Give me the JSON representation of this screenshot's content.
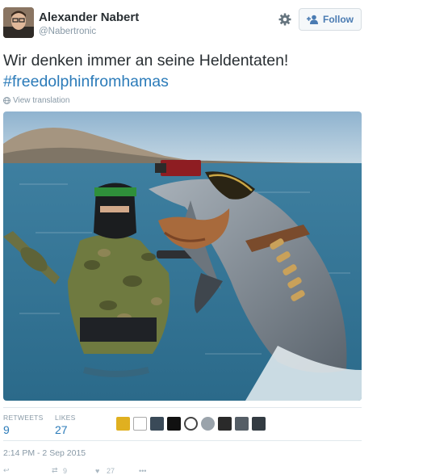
{
  "user": {
    "name": "Alexander Nabert",
    "handle": "@Nabertronic"
  },
  "header": {
    "follow_label": "Follow",
    "settings_icon": "gear-icon"
  },
  "tweet": {
    "text": "Wir denken immer an seine Heldentaten!",
    "hashtag": "#freedolphinfromhamas",
    "translate_label": "View translation"
  },
  "stats": {
    "retweets_label": "RETWEETS",
    "retweets_count": "9",
    "likes_label": "LIKES",
    "likes_count": "27"
  },
  "timestamp": "2:14 PM - 2 Sep 2015",
  "actions": {
    "retweet_count": "9",
    "like_count": "27"
  },
  "colors": {
    "link": "#2b7bb9",
    "muted": "#8899a6",
    "text": "#292f33"
  }
}
